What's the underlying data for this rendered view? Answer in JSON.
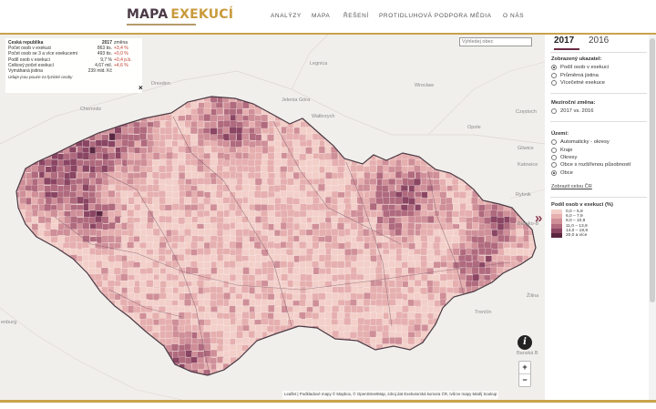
{
  "header": {
    "logo_part1": "MAPA",
    "logo_part2": "EXEKUCÍ",
    "nav": [
      "ANALÝZY",
      "MAPA",
      "ŘEŠENÍ",
      "PROTIDLUHOVÁ PODPORA",
      "MÉDIA",
      "O NÁS"
    ]
  },
  "info_box": {
    "head": {
      "label": "Česká republika",
      "value": "2017",
      "change": "změna"
    },
    "rows": [
      {
        "label": "Počet osob v exekuci",
        "value": "863 tis.",
        "change": "+3,4 %"
      },
      {
        "label": "Počet osob se 3 a více exekucemi",
        "value": "493 tis.",
        "change": "+0,0 %"
      },
      {
        "label": "Podíl osob v exekuci",
        "value": "9,7 %",
        "change": "+0,4 p.b."
      },
      {
        "label": "Celkový počet exekucí",
        "value": "4,67 mil.",
        "change": "+4,6 %"
      },
      {
        "label": "Vymáhaná jistina",
        "value": "239 mld. Kč",
        "change": ""
      }
    ],
    "note": "Údaje jsou pouze za fyzické osoby",
    "close": "×"
  },
  "search": {
    "placeholder": "Vyhledej obec"
  },
  "places": [
    {
      "name": "Dresden"
    },
    {
      "name": "Legnica"
    },
    {
      "name": "Wrocław"
    },
    {
      "name": "Jelenia Góra"
    },
    {
      "name": "Wałbrzych"
    },
    {
      "name": "Opole"
    },
    {
      "name": "Chemnitz"
    },
    {
      "name": "Częstoch"
    },
    {
      "name": "Rybnik"
    },
    {
      "name": "Gliwice"
    },
    {
      "name": "Katowice"
    },
    {
      "name": "Bielsko-B"
    },
    {
      "name": "Žilina"
    },
    {
      "name": "Trenčín"
    },
    {
      "name": "Banská B"
    },
    {
      "name": "enburg"
    }
  ],
  "map_controls": {
    "info": "i",
    "zoom_in": "+",
    "zoom_out": "−",
    "expand": "»"
  },
  "attribution": "Leaflet | Podkladové mapy © Mapbox, © OpenStreetMap, zdroj dat Exekutorská komora ČR, tvůrce mapy Matěj Soukup",
  "panel": {
    "years": [
      "2017",
      "2016"
    ],
    "active_year": "2017",
    "indicator": {
      "title": "Zobrazený ukazatel:",
      "options": [
        "Podíl osob v exekuci",
        "Průměrná jistina",
        "Vícečetné exekuce"
      ],
      "selected": 0
    },
    "change": {
      "title": "Meziroční změna:",
      "options": [
        "2017 vs. 2016"
      ]
    },
    "territory": {
      "title": "Území:",
      "options": [
        "Automaticky - okresy",
        "Kraje",
        "Okresy",
        "Obce s rozšířenou působností",
        "Obce"
      ],
      "selected": 4
    },
    "show_all_link": "Zobrazit celou ČR",
    "legend": {
      "title": "Podíl osob v exekuci (%)",
      "items": [
        {
          "label": "0,0 – 5,9",
          "color": "#f3cfc9"
        },
        {
          "label": "6,0 – 7,9",
          "color": "#e6afaf"
        },
        {
          "label": "8,0 – 10,9",
          "color": "#cf8f98"
        },
        {
          "label": "11,0 – 13,9",
          "color": "#b06a7e"
        },
        {
          "label": "14,0 – 19,9",
          "color": "#8a4563"
        },
        {
          "label": "20,0 a více",
          "color": "#5a2640"
        }
      ]
    }
  }
}
